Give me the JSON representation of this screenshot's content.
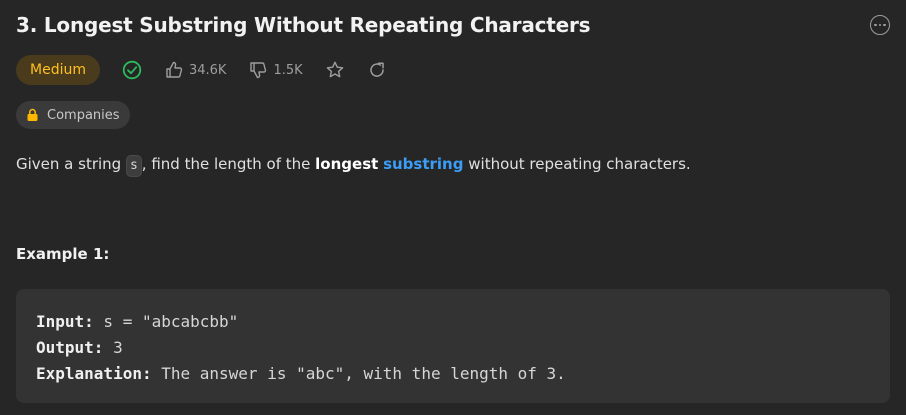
{
  "problem": {
    "title": "3. Longest Substring Without Repeating Characters",
    "difficulty": "Medium",
    "likes": "34.6K",
    "dislikes": "1.5K",
    "companies_label": "Companies"
  },
  "description": {
    "part1": "Given a string ",
    "code_s": "s",
    "part2": ", find the length of the ",
    "bold_word": "longest",
    "space": " ",
    "link_word": "substring",
    "part3": " without repeating characters."
  },
  "example": {
    "title": "Example 1:",
    "input_label": "Input:",
    "input_value": " s = \"abcabcbb\"",
    "output_label": "Output:",
    "output_value": " 3",
    "explanation_label": "Explanation:",
    "explanation_value": " The answer is \"abc\", with the length of 3."
  },
  "colors": {
    "background": "#262626",
    "difficulty_text": "#ffc01e",
    "difficulty_bg": "#4a3b1c",
    "solved_check": "#2cbb5d",
    "link": "#3b9df5",
    "lock": "#ffb800"
  },
  "icons": [
    "more-options-icon",
    "solved-check-icon",
    "thumbs-up-icon",
    "thumbs-down-icon",
    "star-icon",
    "share-icon",
    "lock-icon"
  ]
}
